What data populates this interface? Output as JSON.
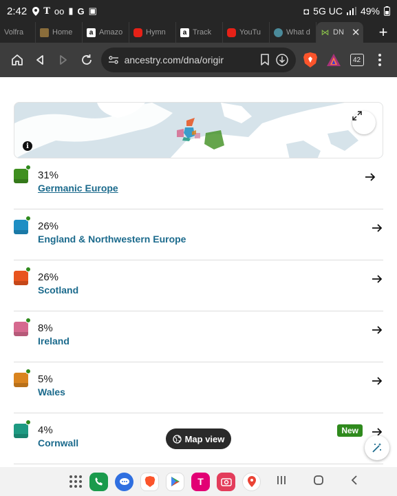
{
  "status_bar": {
    "time": "2:42",
    "network": "5G UC",
    "battery": "49%"
  },
  "tabs": [
    {
      "label": "Volfra",
      "icon": "generic-tab-icon",
      "color": "#555555"
    },
    {
      "label": "Home",
      "icon": "home-tab-icon",
      "color": "#8a6d3b"
    },
    {
      "label": "Amazo",
      "icon": "amazon-icon",
      "color": "#ffffff"
    },
    {
      "label": "Hymn",
      "icon": "youtube-icon",
      "color": "#e62117"
    },
    {
      "label": "Track",
      "icon": "amazon-icon",
      "color": "#ffffff"
    },
    {
      "label": "YouTu",
      "icon": "youtube-icon",
      "color": "#e62117"
    },
    {
      "label": "What d",
      "icon": "globe-icon",
      "color": "#4a8a9a"
    },
    {
      "label": "DN",
      "icon": "dna-icon",
      "color": "#8bc34a",
      "active": true
    }
  ],
  "toolbar": {
    "url": "ancestry.com/dna/origir",
    "tab_count": "42"
  },
  "map": {
    "has_info": true
  },
  "regions": [
    {
      "percent": "31%",
      "name": "Germanic Europe",
      "color": "#3f8f1f",
      "new": false
    },
    {
      "percent": "26%",
      "name": "England & Northwestern Europe",
      "color": "#1f8fc4",
      "new": false
    },
    {
      "percent": "26%",
      "name": "Scotland",
      "color": "#e8541e",
      "new": false
    },
    {
      "percent": "8%",
      "name": "Ireland",
      "color": "#d66a8f",
      "new": false
    },
    {
      "percent": "5%",
      "name": "Wales",
      "color": "#d9841f",
      "new": false
    },
    {
      "percent": "4%",
      "name": "Cornwall",
      "color": "#1e9a82",
      "new": true
    }
  ],
  "badges": {
    "new_label": "New"
  },
  "buttons": {
    "map_view_label": "Map view"
  }
}
